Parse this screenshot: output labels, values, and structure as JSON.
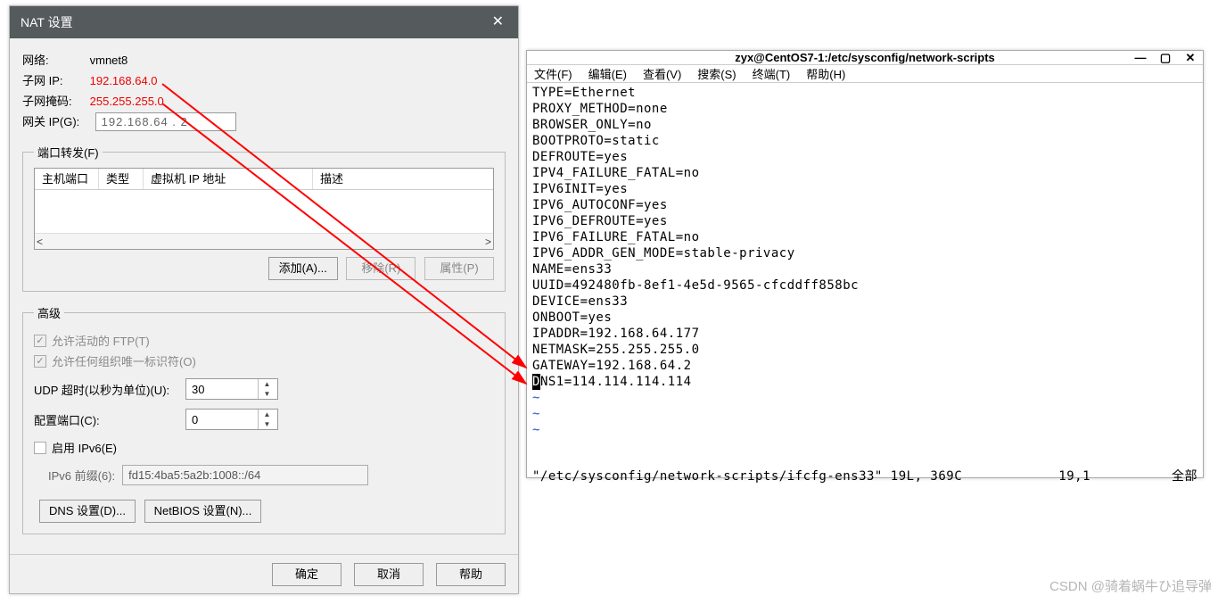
{
  "nat": {
    "title": "NAT 设置",
    "network_label": "网络:",
    "network_value": "vmnet8",
    "subnet_ip_label": "子网 IP:",
    "subnet_ip_value": "192.168.64.0",
    "subnet_mask_label": "子网掩码:",
    "subnet_mask_value": "255.255.255.0",
    "gateway_label": "网关 IP(G):",
    "gateway_value": "192.168.64 . 2",
    "pf": {
      "legend": "端口转发(F)",
      "cols": {
        "host_port": "主机端口",
        "type": "类型",
        "vm_ip": "虚拟机 IP 地址",
        "desc": "描述"
      },
      "add_btn": "添加(A)...",
      "remove_btn": "移除(R)",
      "props_btn": "属性(P)"
    },
    "adv": {
      "legend": "高级",
      "allow_ftp": "允许活动的 FTP(T)",
      "allow_oui": "允许任何组织唯一标识符(O)",
      "udp_label": "UDP 超时(以秒为单位)(U):",
      "udp_value": "30",
      "cfg_port_label": "配置端口(C):",
      "cfg_port_value": "0",
      "enable_ipv6": "启用 IPv6(E)",
      "ipv6_prefix_label": "IPv6 前缀(6):",
      "ipv6_prefix_value": "fd15:4ba5:5a2b:1008::/64",
      "dns_btn": "DNS 设置(D)...",
      "netbios_btn": "NetBIOS 设置(N)..."
    },
    "footer": {
      "ok": "确定",
      "cancel": "取消",
      "help": "帮助"
    }
  },
  "term": {
    "title": "zyx@CentOS7-1:/etc/sysconfig/network-scripts",
    "menu": {
      "file": "文件(F)",
      "edit": "编辑(E)",
      "view": "查看(V)",
      "search": "搜索(S)",
      "terminal": "终端(T)",
      "help": "帮助(H)"
    },
    "lines": [
      "TYPE=Ethernet",
      "PROXY_METHOD=none",
      "BROWSER_ONLY=no",
      "BOOTPROTO=static",
      "DEFROUTE=yes",
      "IPV4_FAILURE_FATAL=no",
      "IPV6INIT=yes",
      "IPV6_AUTOCONF=yes",
      "IPV6_DEFROUTE=yes",
      "IPV6_FAILURE_FATAL=no",
      "IPV6_ADDR_GEN_MODE=stable-privacy",
      "NAME=ens33",
      "UUID=492480fb-8ef1-4e5d-9565-cfcddff858bc",
      "DEVICE=ens33",
      "ONBOOT=yes",
      "IPADDR=192.168.64.177",
      "NETMASK=255.255.255.0",
      "GATEWAY=192.168.64.2"
    ],
    "cursor_line_rest": "NS1=114.114.114.114",
    "cursor_char": "D",
    "status_left": "\"/etc/sysconfig/network-scripts/ifcfg-ens33\" 19L, 369C",
    "status_pos": "19,1",
    "status_right": "全部"
  },
  "watermark": "CSDN @骑着蜗牛ひ追导弹"
}
